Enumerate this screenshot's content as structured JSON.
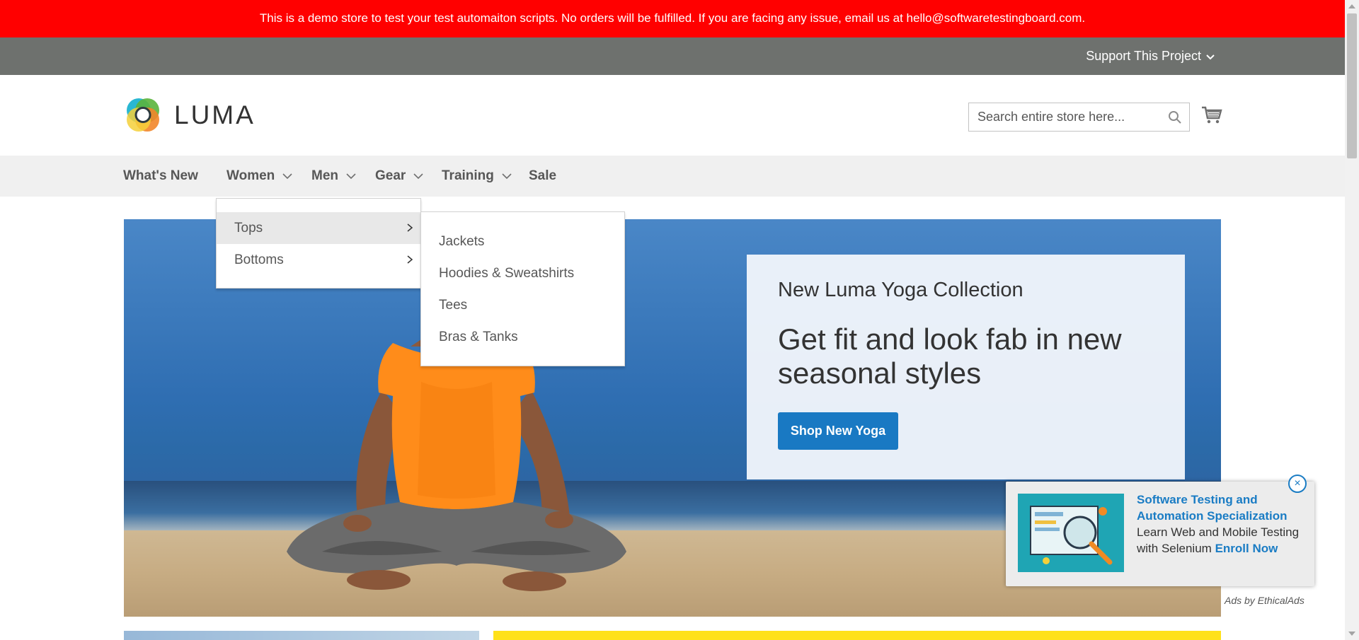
{
  "notice": {
    "text": "This is a demo store to test your test automaiton scripts. No orders will be fulfilled. If you are facing any issue, email us at hello@softwaretestingboard.com."
  },
  "support": {
    "label": "Support This Project"
  },
  "header": {
    "logo_text": "LUMA",
    "search": {
      "placeholder": "Search entire store here..."
    }
  },
  "nav": {
    "items": [
      {
        "label": "What's New",
        "has_dropdown": false
      },
      {
        "label": "Women",
        "has_dropdown": true
      },
      {
        "label": "Men",
        "has_dropdown": true
      },
      {
        "label": "Gear",
        "has_dropdown": true
      },
      {
        "label": "Training",
        "has_dropdown": true
      },
      {
        "label": "Sale",
        "has_dropdown": false
      }
    ]
  },
  "women_menu": {
    "items": [
      {
        "label": "Tops",
        "active": true
      },
      {
        "label": "Bottoms",
        "active": false
      }
    ]
  },
  "tops_menu": {
    "items": [
      {
        "label": "Jackets"
      },
      {
        "label": "Hoodies & Sweatshirts"
      },
      {
        "label": "Tees"
      },
      {
        "label": "Bras & Tanks"
      }
    ]
  },
  "hero": {
    "subtitle": "New Luma Yoga Collection",
    "headline": "Get fit and look fab in new seasonal styles",
    "button_label": "Shop New Yoga"
  },
  "ad": {
    "title": "Software Testing and Automation Specialization",
    "body": "Learn Web and Mobile Testing with Selenium",
    "cta": "Enroll Now",
    "close_label": "×",
    "attribution": "Ads by EthicalAds"
  },
  "colors": {
    "notice_bg": "#ff0000",
    "support_bg": "#6e716e",
    "nav_bg": "#f0f0f0",
    "button_blue": "#1979c3",
    "ad_link": "#1a7cc4"
  }
}
